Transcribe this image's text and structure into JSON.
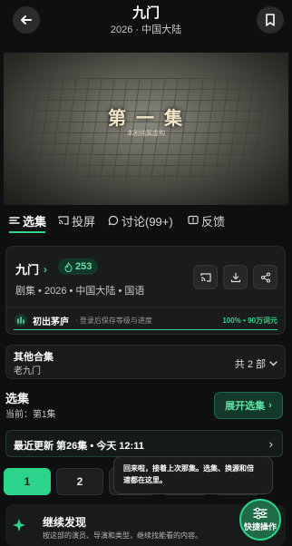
{
  "header": {
    "title": "九门",
    "subtitle": "2026 · 中国大陆",
    "back_icon": "arrow-left-icon",
    "favorite_icon": "bookmark-icon"
  },
  "video": {
    "caption_main": "第 一 集",
    "caption_sub": "本剧纯属虚构"
  },
  "tabs": [
    {
      "label": "选集",
      "icon": "list-icon",
      "active": true
    },
    {
      "label": "投屏",
      "icon": "cast-icon",
      "active": false
    },
    {
      "label": "讨论(99+)",
      "icon": "chat-icon",
      "active": false
    },
    {
      "label": "反馈",
      "icon": "feedback-icon",
      "active": false
    }
  ],
  "card": {
    "title": "九门",
    "heat": "253",
    "meta": "剧集 • 2026 • 中国大陆 • 国语",
    "progress_label": "初出茅庐",
    "progress_hint": "· 登录后保存等级与进度",
    "progress_value": "100% • 90万词元",
    "progress_fraction": 1.0
  },
  "collection": {
    "title": "其他合集",
    "subtitle": "老九门",
    "count": "共 2 部"
  },
  "episodes": {
    "title": "选集",
    "current": "当前：第1集",
    "expand_label": "展开选集",
    "latest": "最近更新 第26集 • 今天 12:11",
    "chips": [
      "1",
      "2"
    ]
  },
  "tooltip": {
    "line1": "回来啦，接着上次那集。选集、换源和倍",
    "line2": "速都在这里。"
  },
  "discover": {
    "title": "继续发现",
    "subtitle": "按这部的演员、导演和类型，继续找能看的内容。"
  },
  "fab": {
    "label": "快捷操作"
  },
  "colors": {
    "accent": "#2bd48a",
    "background": "#0e0f10",
    "card": "#1a1b1d"
  }
}
